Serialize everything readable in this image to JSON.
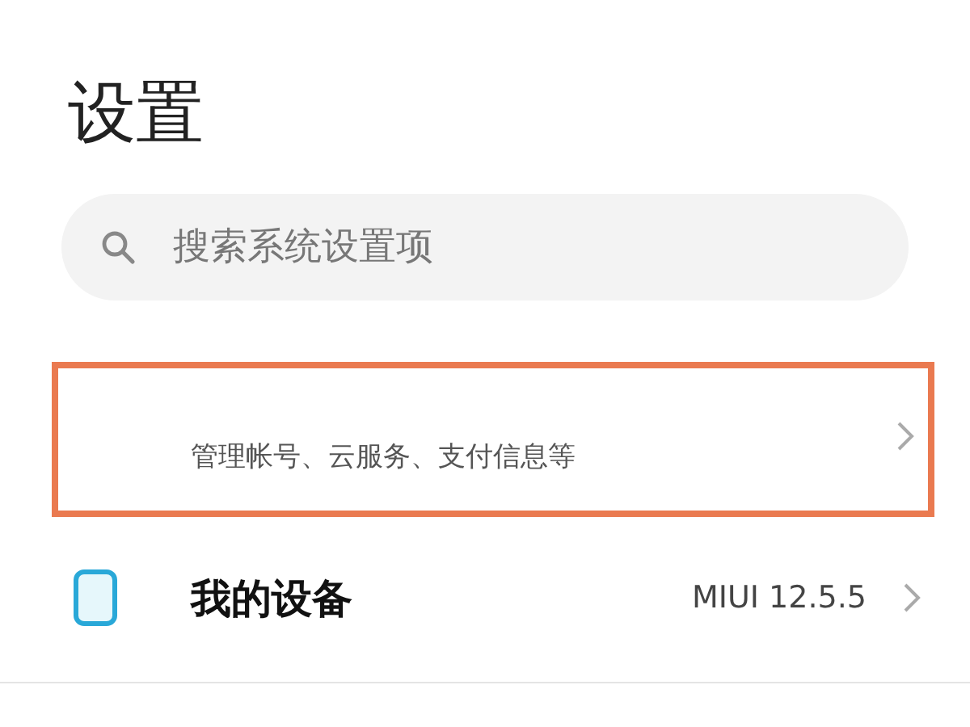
{
  "title": "设置",
  "search": {
    "placeholder": "搜索系统设置项"
  },
  "account": {
    "subtitle": "管理帐号、云服务、支付信息等",
    "highlighted": true
  },
  "rows": [
    {
      "kind": "device",
      "label": "我的设备",
      "value": "MIUI 12.5.5"
    }
  ]
}
